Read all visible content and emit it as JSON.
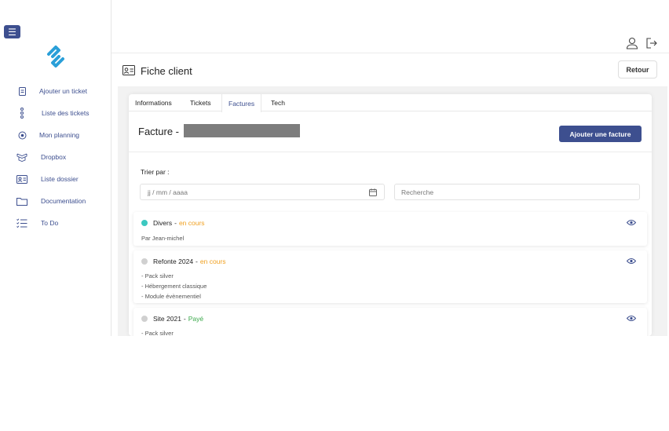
{
  "sidebar": {
    "items": [
      {
        "label": "Ajouter un ticket",
        "icon": "document-icon"
      },
      {
        "label": "Liste des tickets",
        "icon": "dots-vertical-icon"
      },
      {
        "label": "Mon planning",
        "icon": "target-icon"
      },
      {
        "label": "Dropbox",
        "icon": "dropbox-icon"
      },
      {
        "label": "Liste dossier",
        "icon": "id-card-icon"
      },
      {
        "label": "Documentation",
        "icon": "folder-icon"
      },
      {
        "label": "To Do",
        "icon": "checklist-icon"
      }
    ]
  },
  "header": {
    "page_title": "Fiche client",
    "retour_label": "Retour"
  },
  "tabs": [
    {
      "label": "Informations"
    },
    {
      "label": "Tickets"
    },
    {
      "label": "Factures",
      "active": true
    },
    {
      "label": "Tech"
    }
  ],
  "facture": {
    "title": "Facture -",
    "add_label": "Ajouter une facture",
    "sort_label": "Trier par :",
    "date_placeholder": "jj / mm / aaaa",
    "search_placeholder": "Recherche"
  },
  "invoices": [
    {
      "name": "Divers",
      "status": "en cours",
      "status_color": "#f0a020",
      "dot_color": "#3cc8c0",
      "lines": [
        "Par Jean-michel"
      ]
    },
    {
      "name": "Refonte 2024",
      "status": "en cours",
      "status_color": "#f0a020",
      "dot_color": "#d0d0d0",
      "lines": [
        "- Pack silver",
        "- Hébergement classique",
        "- Module évènementiel"
      ]
    },
    {
      "name": "Site 2021",
      "status": "Payé",
      "status_color": "#3aa84a",
      "dot_color": "#d0d0d0",
      "lines": [
        "- Pack silver"
      ]
    }
  ],
  "colors": {
    "accent": "#3d4f8f",
    "logo": "#2a9fd8"
  }
}
